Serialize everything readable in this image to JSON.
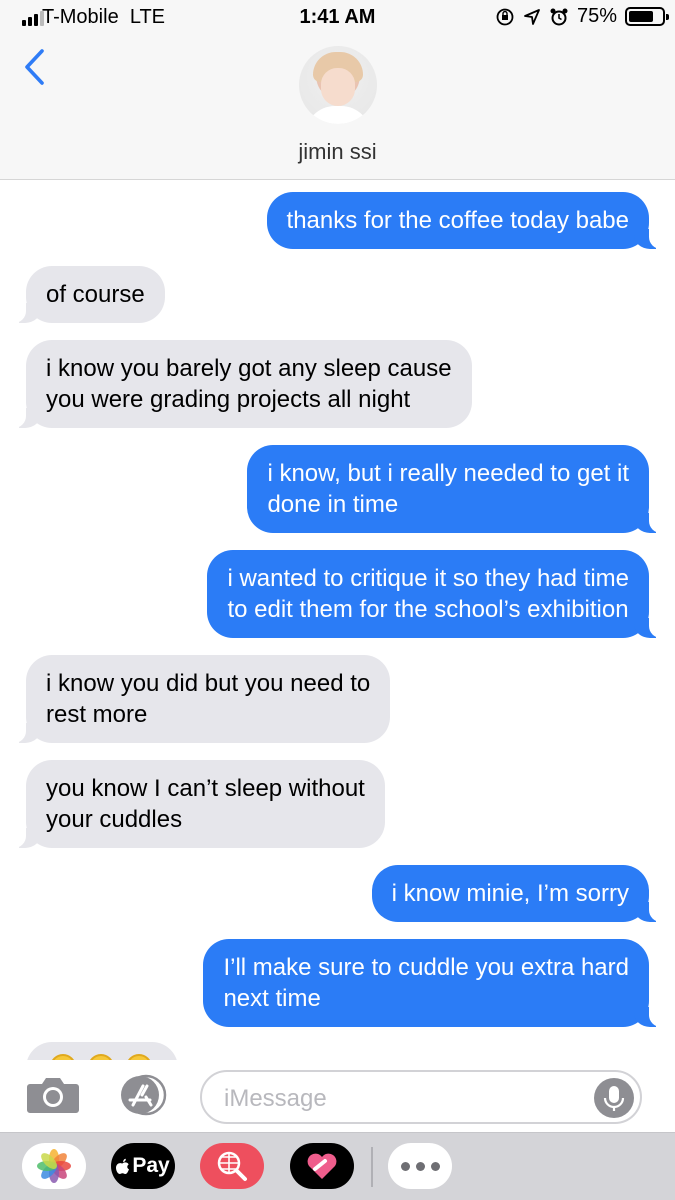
{
  "status_bar": {
    "carrier": "T-Mobile",
    "network": "LTE",
    "time": "1:41 AM",
    "battery_text": "75%",
    "battery_level": 0.75,
    "icons": [
      "signal-bars-icon",
      "rotation-lock-icon",
      "location-arrow-icon",
      "alarm-icon",
      "battery-icon"
    ]
  },
  "header": {
    "back_icon": "chevron-left-icon",
    "contact_name": "jimin ssi"
  },
  "messages": [
    {
      "from": "me",
      "lines": [
        "thanks for the coffee today babe"
      ]
    },
    {
      "from": "them",
      "lines": [
        "of course"
      ]
    },
    {
      "from": "them",
      "lines": [
        "i know you barely got any sleep cause",
        "you were grading projects all night"
      ]
    },
    {
      "from": "me",
      "lines": [
        "i know, but i really needed to get it",
        "done in time"
      ]
    },
    {
      "from": "me",
      "lines": [
        "i wanted to critique it so they had time",
        "to edit them for the school’s exhibition"
      ]
    },
    {
      "from": "them",
      "lines": [
        "i know you did but you need to",
        "rest more"
      ]
    },
    {
      "from": "them",
      "lines": [
        "you know I can’t sleep without",
        "your cuddles"
      ]
    },
    {
      "from": "me",
      "lines": [
        "i know minie, I’m sorry"
      ]
    },
    {
      "from": "me",
      "lines": [
        "I’ll make sure to cuddle you extra hard",
        "next time"
      ]
    }
  ],
  "input_bar": {
    "camera_icon": "camera-icon",
    "app_store_icon": "app-store-icon",
    "placeholder": "iMessage",
    "mic_icon": "microphone-icon"
  },
  "app_drawer": {
    "apps": [
      "photos-icon",
      "apple-pay-icon",
      "image-search-icon",
      "digital-touch-icon",
      "more-icon"
    ],
    "apple_pay_label": "Pay"
  },
  "colors": {
    "sent_bubble": "#2b7cf6",
    "received_bubble": "#e6e6eb",
    "accent": "#2f7cf6"
  }
}
